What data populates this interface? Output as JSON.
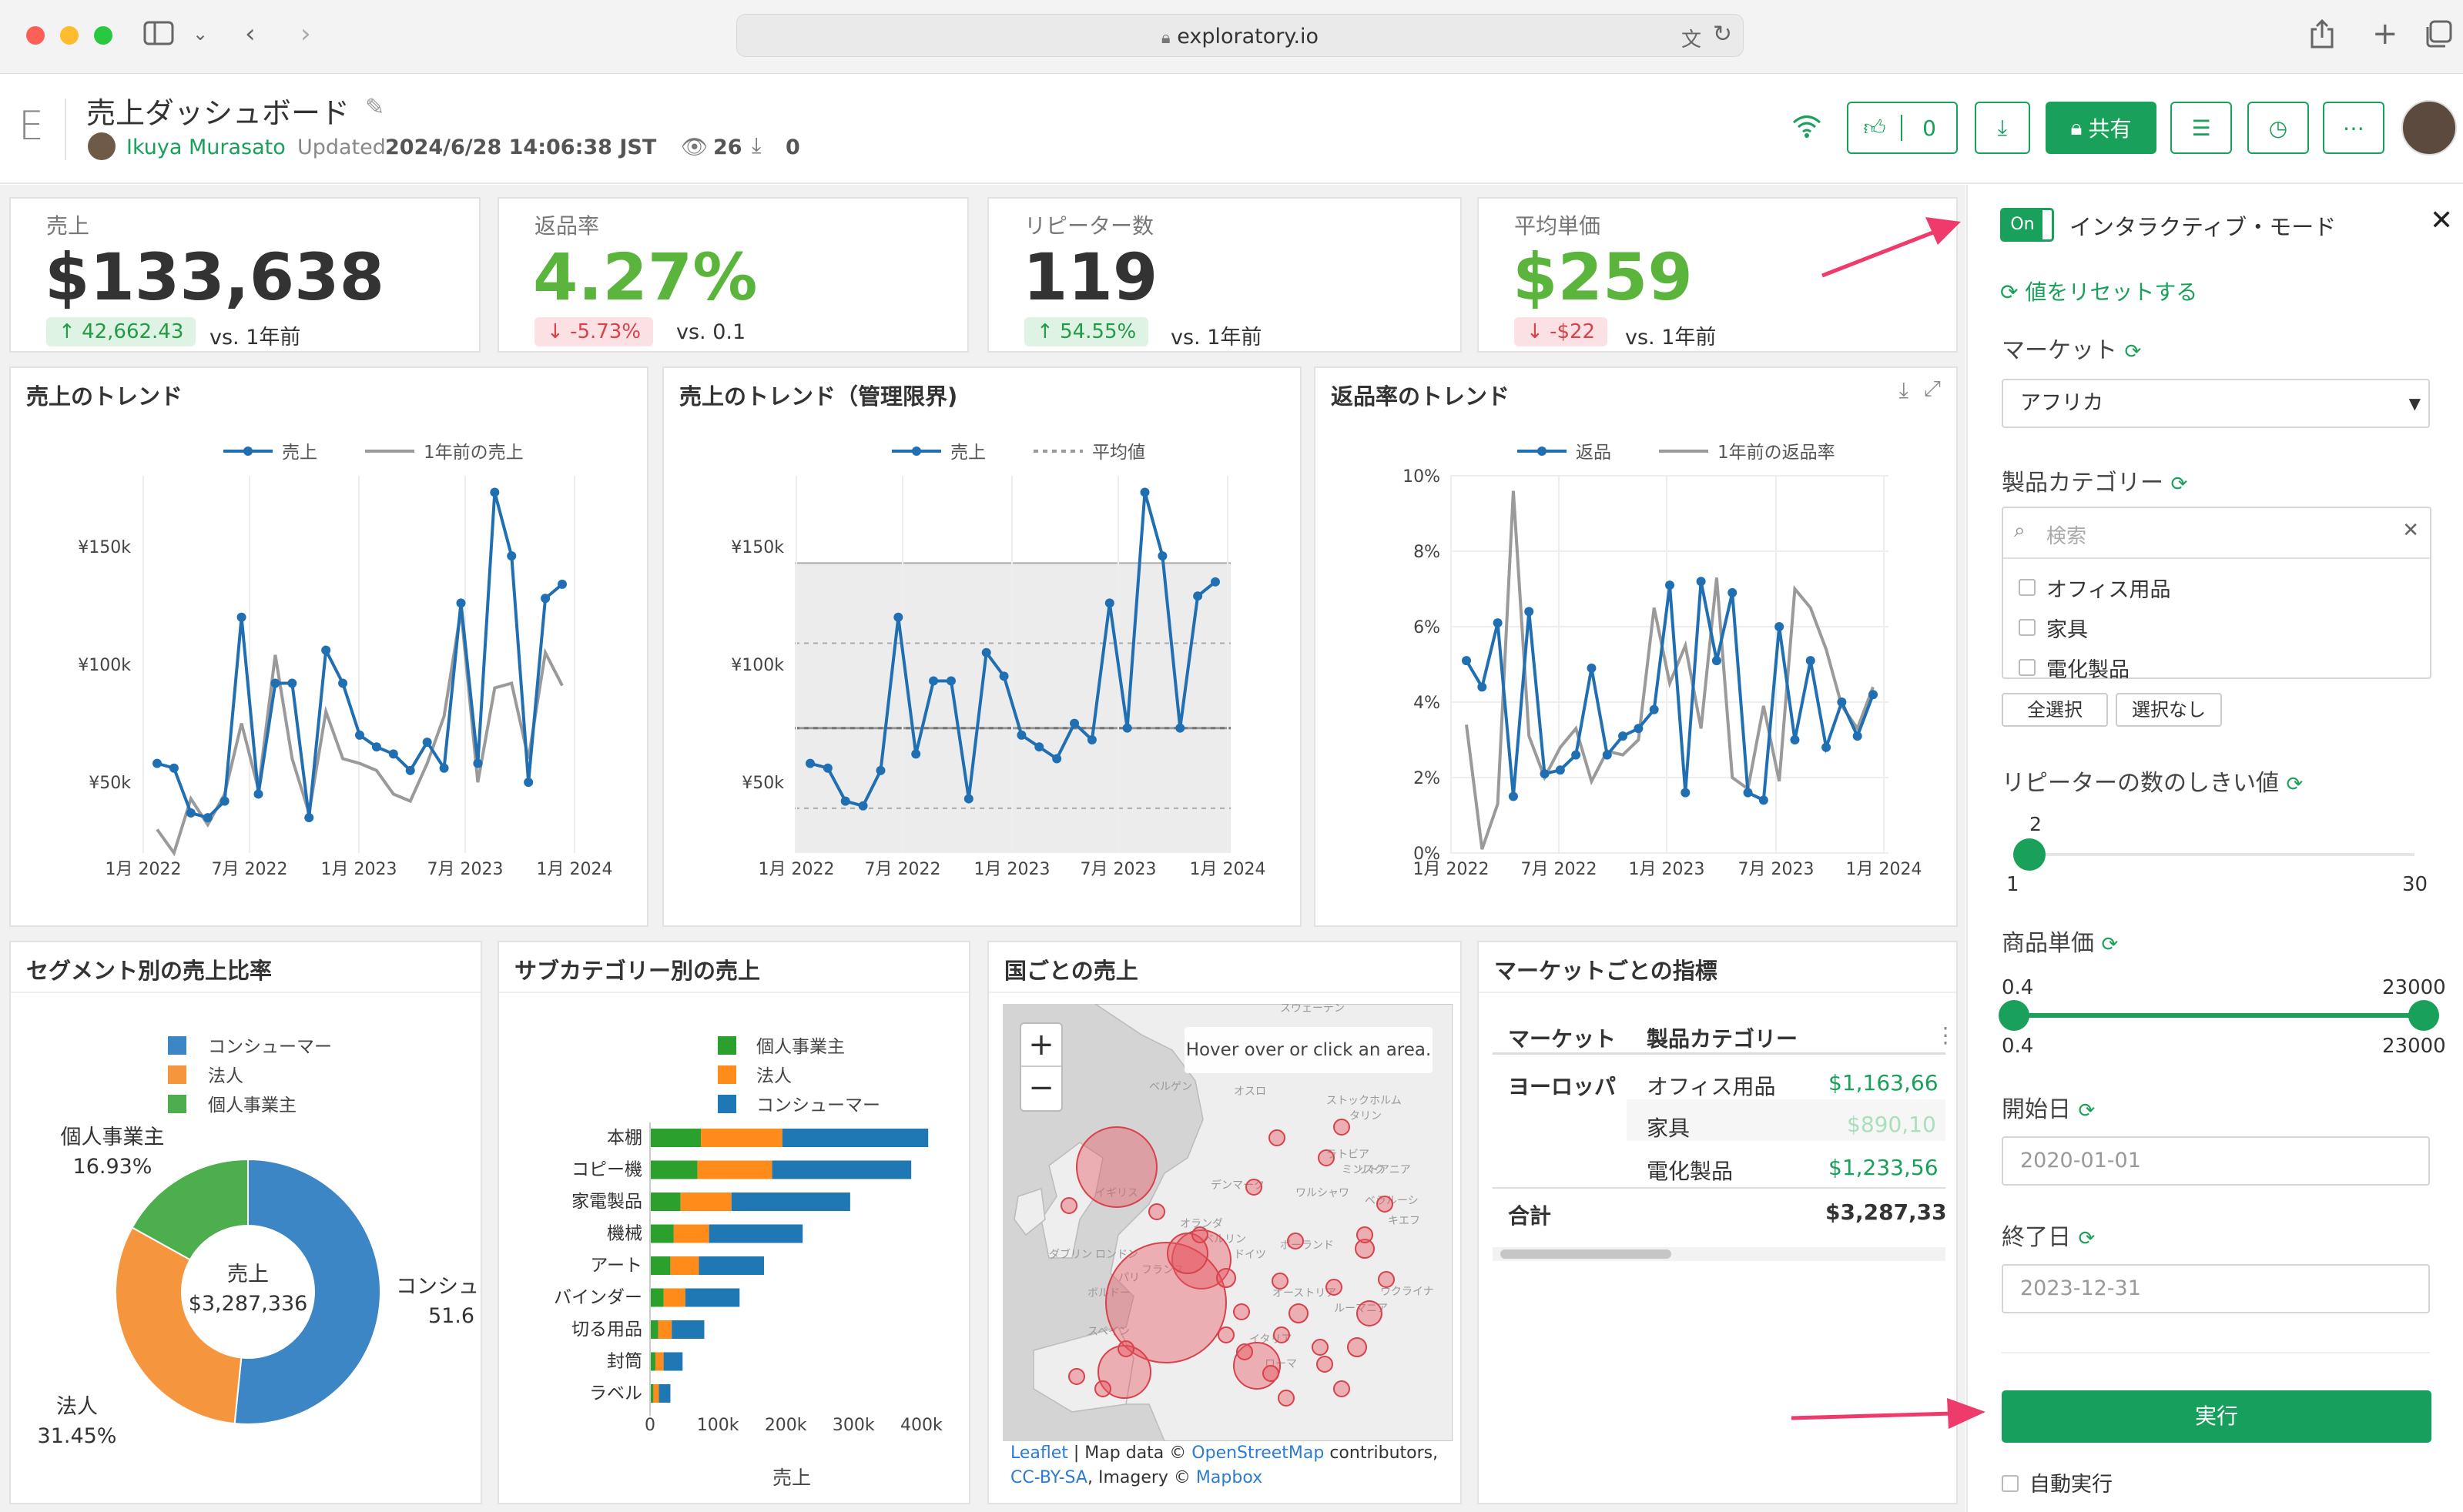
{
  "browser": {
    "url": "exploratory.io"
  },
  "header": {
    "logo": "E",
    "title": "売上ダッシュボード",
    "author": "Ikuya Murasato",
    "updated_label": "Updated",
    "updated_value": "2024/6/28 14:06:38 JST",
    "views": "26",
    "downloads": "0",
    "likes": "0",
    "share_label": "共有"
  },
  "kpis": [
    {
      "label": "売上",
      "value": "$133,638",
      "badge": "42,662.43",
      "direction": "up",
      "vs": "vs. 1年前",
      "value_color": "#333333"
    },
    {
      "label": "返品率",
      "value": "4.27%",
      "badge": "-5.73%",
      "direction": "down",
      "vs": "vs. 0.1",
      "value_color": "#5bb53c"
    },
    {
      "label": "リピーター数",
      "value": "119",
      "badge": "54.55%",
      "direction": "up",
      "vs": "vs. 1年前",
      "value_color": "#333333"
    },
    {
      "label": "平均単価",
      "value": "$259",
      "badge": "-$22",
      "direction": "down",
      "vs": "vs. 1年前",
      "value_color": "#5bb53c"
    }
  ],
  "charts": {
    "sales_trend": {
      "title": "売上のトレンド"
    },
    "sales_control": {
      "title": "売上のトレンド（管理限界)"
    },
    "return_trend": {
      "title": "返品率のトレンド"
    },
    "segment_share": {
      "title": "セグメント別の売上比率"
    },
    "subcategory_sales": {
      "title": "サブカテゴリー別の売上"
    },
    "country_sales": {
      "title": "国ごとの売上"
    },
    "market_metrics": {
      "title": "マーケットごとの指標"
    }
  },
  "chart_data": [
    {
      "type": "line",
      "title": "売上のトレンド",
      "x_ticks": [
        "1月 2022",
        "7月 2022",
        "1月 2023",
        "7月 2023",
        "1月 2024"
      ],
      "y_ticks": [
        "¥50k",
        "¥100k",
        "¥150k"
      ],
      "ylim": [
        20000,
        180000
      ],
      "series": [
        {
          "name": "売上",
          "color": "#1f6fb2",
          "marker": true,
          "values": [
            58000,
            56000,
            37000,
            35000,
            42000,
            120000,
            45000,
            92000,
            92000,
            35000,
            106000,
            92000,
            70000,
            65000,
            62000,
            55000,
            67000,
            56000,
            126000,
            58000,
            173000,
            146000,
            50000,
            128000,
            134000
          ]
        },
        {
          "name": "1年前の売上",
          "color": "#9a9a9a",
          "marker": false,
          "values": [
            30000,
            20000,
            43000,
            32000,
            45000,
            75000,
            47000,
            104000,
            60000,
            37000,
            80000,
            60000,
            58000,
            55000,
            45000,
            42000,
            58000,
            78000,
            123000,
            50000,
            90000,
            92000,
            60000,
            105000,
            91000
          ]
        }
      ]
    },
    {
      "type": "line",
      "title": "売上のトレンド（管理限界)",
      "x_ticks": [
        "1月 2022",
        "7月 2022",
        "1月 2023",
        "7月 2023",
        "1月 2024"
      ],
      "y_ticks": [
        "¥50k",
        "¥100k",
        "¥150k"
      ],
      "ylim": [
        20000,
        180000
      ],
      "control_band": [
        20000,
        143000
      ],
      "mean": 73000,
      "sigma_lines": [
        39000,
        109000
      ],
      "series": [
        {
          "name": "売上",
          "color": "#1f6fb2",
          "marker": true,
          "values": [
            58000,
            56000,
            42000,
            40000,
            55000,
            120000,
            62000,
            93000,
            93000,
            43000,
            105000,
            95000,
            70000,
            65000,
            60000,
            75000,
            68000,
            126000,
            73000,
            173000,
            146000,
            73000,
            129000,
            135000
          ]
        },
        {
          "name": "平均値",
          "color": "#9a9a9a",
          "marker": false,
          "dashed": true,
          "values": []
        }
      ]
    },
    {
      "type": "line",
      "title": "返品率のトレンド",
      "x_ticks": [
        "1月 2022",
        "7月 2022",
        "1月 2023",
        "7月 2023",
        "1月 2024"
      ],
      "y_ticks": [
        "0%",
        "2%",
        "4%",
        "6%",
        "8%",
        "10%"
      ],
      "ylim": [
        0,
        10
      ],
      "series": [
        {
          "name": "返品",
          "color": "#1f6fb2",
          "marker": true,
          "values": [
            5.1,
            4.4,
            6.1,
            1.5,
            6.4,
            2.1,
            2.2,
            2.6,
            4.9,
            2.6,
            3.1,
            3.3,
            3.8,
            7.1,
            1.6,
            7.2,
            5.1,
            6.9,
            1.6,
            1.4,
            6.0,
            3.0,
            5.1,
            2.8,
            4.0,
            3.1,
            4.2
          ]
        },
        {
          "name": "1年前の返品率",
          "color": "#9a9a9a",
          "marker": false,
          "values": [
            3.4,
            0.1,
            1.3,
            9.6,
            3.1,
            2.0,
            2.8,
            3.3,
            1.9,
            2.7,
            2.6,
            3.0,
            6.5,
            4.5,
            5.5,
            3.3,
            7.3,
            2.0,
            1.7,
            3.9,
            1.9,
            7.0,
            6.5,
            5.4,
            3.9,
            3.3,
            4.4
          ]
        }
      ]
    },
    {
      "type": "pie",
      "title": "セグメント別の売上比率",
      "center_label": "売上",
      "center_value": "$3,287,336",
      "slices": [
        {
          "name": "コンシューマー",
          "value": 51.6,
          "color": "#3d86c6",
          "label": "コンシュ",
          "pct": "51.6"
        },
        {
          "name": "法人",
          "value": 31.45,
          "color": "#f5963e",
          "label": "法人",
          "pct": "31.45%"
        },
        {
          "name": "個人事業主",
          "value": 16.93,
          "color": "#4cae4c",
          "label": "個人事業主",
          "pct": "16.93%"
        }
      ]
    },
    {
      "type": "bar",
      "orientation": "horizontal",
      "stacked": true,
      "title": "サブカテゴリー別の売上",
      "xlabel": "売上",
      "x_ticks": [
        "0",
        "100k",
        "200k",
        "300k",
        "400k"
      ],
      "xlim": [
        0,
        420000
      ],
      "categories": [
        "本棚",
        "コピー機",
        "家電製品",
        "機械",
        "アート",
        "バインダー",
        "切る用品",
        "封筒",
        "ラベル"
      ],
      "series": [
        {
          "name": "個人事業主",
          "color": "#2ca02c",
          "values": [
            75000,
            70000,
            45000,
            35000,
            30000,
            20000,
            12000,
            8000,
            5000
          ]
        },
        {
          "name": "法人",
          "color": "#ff8c1a",
          "values": [
            120000,
            110000,
            75000,
            52000,
            42000,
            32000,
            20000,
            12000,
            8000
          ]
        },
        {
          "name": "コンシューマー",
          "color": "#1f77b4",
          "values": [
            215000,
            205000,
            175000,
            138000,
            96000,
            80000,
            48000,
            28000,
            17000
          ]
        }
      ]
    }
  ],
  "map": {
    "hover_text": "Hover over or click an area.",
    "zoom_in": "+",
    "zoom_out": "−",
    "labels": [
      "スウェーデン",
      "ベルゲン",
      "オスロ",
      "ストックホルム",
      "タリン",
      "イギリス",
      "ドイツ",
      "ベルリン",
      "ポーランド",
      "フランス",
      "ボルドー",
      "スペイン",
      "ウクライナ",
      "ローマ",
      "ミンスク",
      "キエフ",
      "ルーマニア",
      "ダブリン",
      "ロンドン",
      "パリ",
      "ワルシャワ",
      "ラトビア",
      "リトアニア",
      "デンマーク",
      "オランダ",
      "オーストリア",
      "イタリア",
      "ベラルーシ"
    ],
    "attribution_leaflet": "Leaflet",
    "attribution_mid": "| Map data ©",
    "attribution_osm": "OpenStreetMap",
    "attribution_contrib": "contributors,",
    "attribution_cc": "CC-BY-SA",
    "attribution_imagery": ", Imagery ©",
    "attribution_mapbox": "Mapbox"
  },
  "market_table": {
    "headers": [
      "マーケット",
      "製品カテゴリー"
    ],
    "rows": [
      {
        "market": "ヨーロッパ",
        "category": "オフィス用品",
        "value": "$1,163,66"
      },
      {
        "market": "",
        "category": "家具",
        "value": "$890,10"
      },
      {
        "market": "",
        "category": "電化製品",
        "value": "$1,233,56"
      }
    ],
    "total_label": "合計",
    "total_value": "$3,287,33"
  },
  "panel": {
    "toggle": "On",
    "title": "インタラクティブ・モード",
    "reset": "値をリセットする",
    "market_label": "マーケット",
    "market_value": "アフリカ",
    "category_label": "製品カテゴリー",
    "search_placeholder": "検索",
    "category_options": [
      "オフィス用品",
      "家具",
      "電化製品"
    ],
    "select_all": "全選択",
    "select_none": "選択なし",
    "repeater_label": "リピーターの数のしきい値",
    "repeater_value": "2",
    "repeater_min": "1",
    "repeater_max": "30",
    "price_label": "商品単価",
    "price_low": "0.4",
    "price_high": "23000",
    "price_min": "0.4",
    "price_max": "23000",
    "start_label": "開始日",
    "start_value": "2020-01-01",
    "end_label": "終了日",
    "end_value": "2023-12-31",
    "run": "実行",
    "auto_run": "自動実行"
  },
  "colors": {
    "accent": "#19a05a",
    "arrow": "#ee3b6b"
  }
}
